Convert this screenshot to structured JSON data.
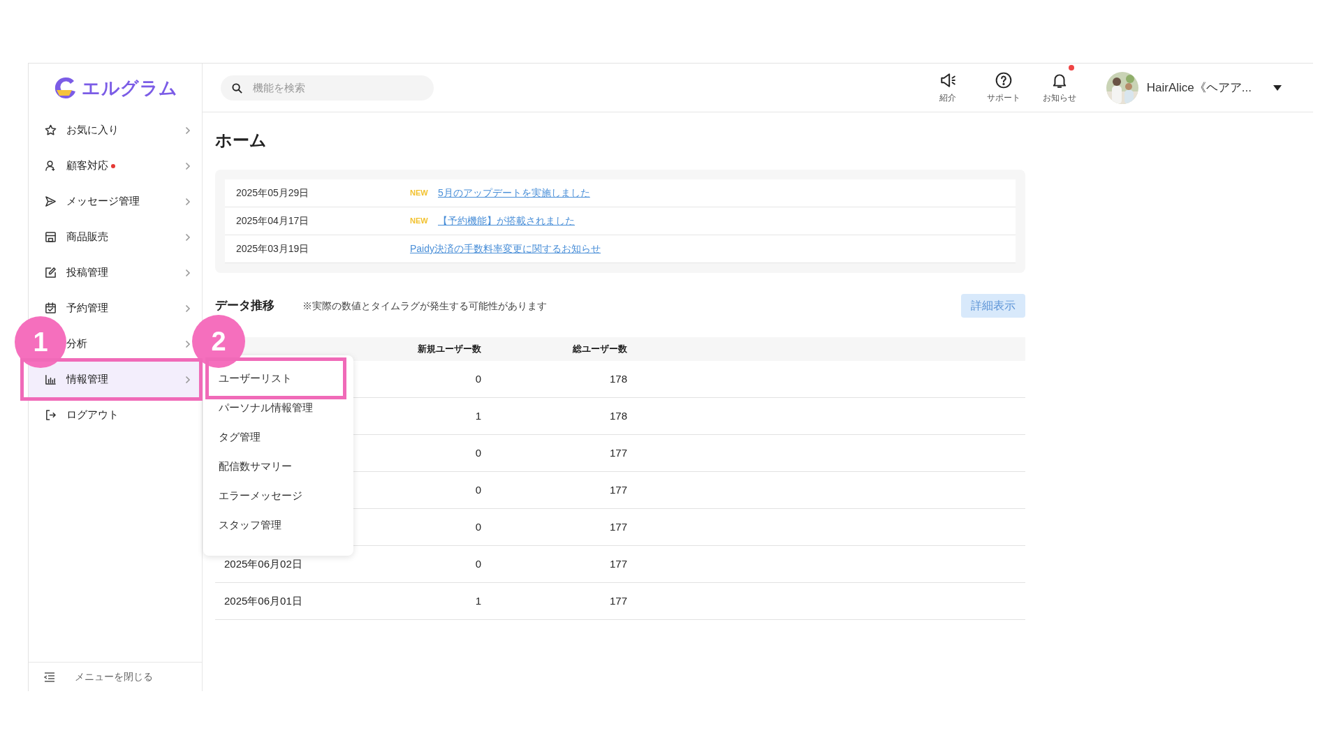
{
  "logo": {
    "text": "エルグラム"
  },
  "search": {
    "placeholder": "機能を検索"
  },
  "header_actions": [
    {
      "label": "紹介",
      "kind": "megaphone",
      "badge": false
    },
    {
      "label": "サポート",
      "kind": "help",
      "badge": false
    },
    {
      "label": "お知らせ",
      "kind": "bell",
      "badge": true
    }
  ],
  "account": {
    "name": "HairAlice《ヘアア..."
  },
  "sidebar": {
    "items": [
      {
        "label": "お気に入り",
        "badge": false,
        "selected": false,
        "highlighted": false,
        "expandable": true
      },
      {
        "label": "顧客対応",
        "badge": true,
        "selected": false,
        "highlighted": false,
        "expandable": true
      },
      {
        "label": "メッセージ管理",
        "badge": false,
        "selected": false,
        "highlighted": false,
        "expandable": true
      },
      {
        "label": "商品販売",
        "badge": false,
        "selected": false,
        "highlighted": false,
        "expandable": true
      },
      {
        "label": "投稿管理",
        "badge": false,
        "selected": false,
        "highlighted": false,
        "expandable": true
      },
      {
        "label": "予約管理",
        "badge": false,
        "selected": false,
        "highlighted": false,
        "expandable": true
      },
      {
        "label": "分析",
        "badge": false,
        "selected": false,
        "highlighted": false,
        "expandable": true
      },
      {
        "label": "情報管理",
        "badge": false,
        "selected": true,
        "highlighted": true,
        "expandable": true
      },
      {
        "label": "ログアウト",
        "badge": false,
        "selected": false,
        "highlighted": false,
        "expandable": false
      }
    ],
    "footer": "メニューを閉じる"
  },
  "page_title": "ホーム",
  "notices": [
    {
      "date": "2025年05月29日",
      "new": true,
      "new_label": "NEW",
      "title": "5月のアップデートを実施しました"
    },
    {
      "date": "2025年04月17日",
      "new": true,
      "new_label": "NEW",
      "title": "【予約機能】が搭載されました"
    },
    {
      "date": "2025年03月19日",
      "new": false,
      "title": "Paidy決済の手数料率変更に関するお知らせ"
    }
  ],
  "data_section": {
    "title": "データ推移",
    "note": "※実際の数値とタイムラグが発生する可能性があります",
    "detail_button": "詳細表示",
    "table": {
      "columns": [
        "新規ユーザー数",
        "総ユーザー数"
      ],
      "rows": [
        {
          "new_users": "0",
          "total_users": "178"
        },
        {
          "new_users": "1",
          "total_users": "178"
        },
        {
          "new_users": "0",
          "total_users": "177"
        },
        {
          "new_users": "0",
          "total_users": "177"
        },
        {
          "new_users": "0",
          "total_users": "177"
        },
        {
          "date": "2025年06月02日",
          "new_users": "0",
          "total_users": "177"
        },
        {
          "date": "2025年06月01日",
          "new_users": "1",
          "total_users": "177"
        }
      ]
    }
  },
  "submenu": {
    "items": [
      {
        "label": "ユーザーリスト",
        "highlighted": true
      },
      {
        "label": "パーソナル情報管理",
        "highlighted": false
      },
      {
        "label": "タグ管理",
        "highlighted": false
      },
      {
        "label": "配信数サマリー",
        "highlighted": false
      },
      {
        "label": "エラーメッセージ",
        "highlighted": false
      },
      {
        "label": "スタッフ管理",
        "highlighted": false
      }
    ]
  },
  "annotations": [
    {
      "label": "1"
    },
    {
      "label": "2"
    }
  ]
}
